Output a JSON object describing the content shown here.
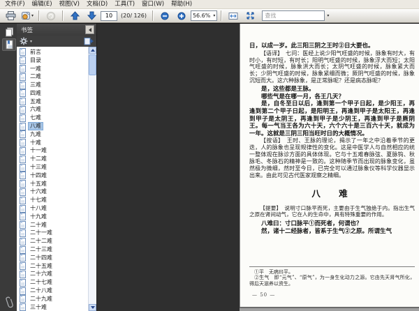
{
  "menu": {
    "items": [
      "文件(F)",
      "编辑(E)",
      "视图(V)",
      "文档(D)",
      "工具(T)",
      "窗口(W)",
      "帮助(H)"
    ]
  },
  "toolbar": {
    "page_input": "10",
    "page_total": "(20/ 126)",
    "zoom_value": "56.6%",
    "find_placeholder": "查找"
  },
  "icons": {
    "toolbar": [
      "print-icon",
      "save-copy-icon",
      "previous-view-icon",
      "page-up-icon",
      "page-down-icon",
      "zoom-out-icon",
      "zoom-in-icon",
      "fit-width-icon",
      "fit-page-icon"
    ],
    "sidebar_rail": [
      "pages-panel-icon",
      "bookmarks-panel-icon",
      "attachments-paperclip-icon"
    ],
    "scroll": [
      "scroll-up-arrow",
      "scroll-down-arrow"
    ]
  },
  "sidebar": {
    "title": "书签",
    "bookmarks": [
      {
        "label": "前言"
      },
      {
        "label": "目录"
      },
      {
        "label": "一难"
      },
      {
        "label": "二难"
      },
      {
        "label": "三难"
      },
      {
        "label": "四难"
      },
      {
        "label": "五难"
      },
      {
        "label": "六难"
      },
      {
        "label": "七难"
      },
      {
        "label": "八难",
        "selected": true
      },
      {
        "label": "九难"
      },
      {
        "label": "十难"
      },
      {
        "label": "十一难"
      },
      {
        "label": "十二难"
      },
      {
        "label": "十三难"
      },
      {
        "label": "十四难"
      },
      {
        "label": "十五难"
      },
      {
        "label": "十六难"
      },
      {
        "label": "十七难"
      },
      {
        "label": "十八难"
      },
      {
        "label": "十九难"
      },
      {
        "label": "二十难"
      },
      {
        "label": "二十一难"
      },
      {
        "label": "二十二难"
      },
      {
        "label": "二十三难"
      },
      {
        "label": "二十四难"
      },
      {
        "label": "二十五难"
      },
      {
        "label": "二十六难"
      },
      {
        "label": "二十七难"
      },
      {
        "label": "二十八难"
      },
      {
        "label": "二十九难"
      },
      {
        "label": "三十难"
      }
    ]
  },
  "document": {
    "paragraphs": [
      {
        "cls": "orig noindent",
        "text": "日，以成一岁。此三阳三阴之王时②日大要也。"
      },
      {
        "cls": "trans",
        "text": "【语译】　七问：医经上说少阳气旺盛的时候，脉象有时大，有时小，有时短，有时长；阳明气旺盛的时候，脉象浮大而短；太阳气旺盛的时候，脉象洪大而长；太阴气旺盛的时候，脉象紧大而长；少阴气旺盛的时候，脉象紧细而微；厥阴气旺盛的时候，脉象沉短而大。这六种脉象，是正常脉呢？还是病态脉呢？"
      },
      {
        "cls": "orig",
        "text": "是，这些都是王脉。"
      },
      {
        "cls": "orig",
        "text": "哪些气是在哪一月，各王几天？"
      },
      {
        "cls": "orig",
        "text": "是，自冬至日以后，逢到第一个甲子日起，是少阳王，再逢到第二个甲子日起，是阳明王，再逢到甲子是太阳王，再逢到甲子是太阴王，再逢到甲子是少阴王，再逢到甲子是厥阴王。每一气当王各为六十天，六个六十是三百六十天，就成为一年。这就是三阴三阳当旺时日的大概情况。"
      },
      {
        "cls": "note",
        "text": "【按语】　王时、王脉的理论，揭示了一年之中沿着季节的更迭，人的脉象也呈现规律性的变化。这是中医学人与自然相应的统一整体观在脉诊方面的具体体现。它与十五难春脉弦、夏脉钩、秋脉毛、冬脉石的精神是一致的。这种随季节而出现的脉象变化，虽然极为微细，然时至今日，已完全可以通过脉象仪等科学仪器显示出来。由此可见古代医家观察之精细。"
      },
      {
        "cls": "chapter",
        "text": "八　难"
      },
      {
        "cls": "abstract",
        "text": "【提要】　说明寸口脉平而死，主要由于生气独绝于内。指出生气之原在肾间动气，它在人的生命中，具有特殊重要的作用。"
      },
      {
        "cls": "orig",
        "text": "八难曰：寸口脉平①而死者，何谓也？"
      },
      {
        "cls": "orig",
        "text": "然，诸十二经脉者，皆系于生气②之原。所谓生气"
      }
    ],
    "footnotes": [
      "①平　无病曰平。",
      "②生气　即“元气”、“原气”，为一身生化动力之源。它由先天肾气所化，得后天滋养以资生。"
    ],
    "page_number": "— 50 —"
  },
  "colors": {
    "accent_blue": "#3273c4",
    "selection": "#a9c7e8",
    "pane_background": "#2f2f2f"
  }
}
